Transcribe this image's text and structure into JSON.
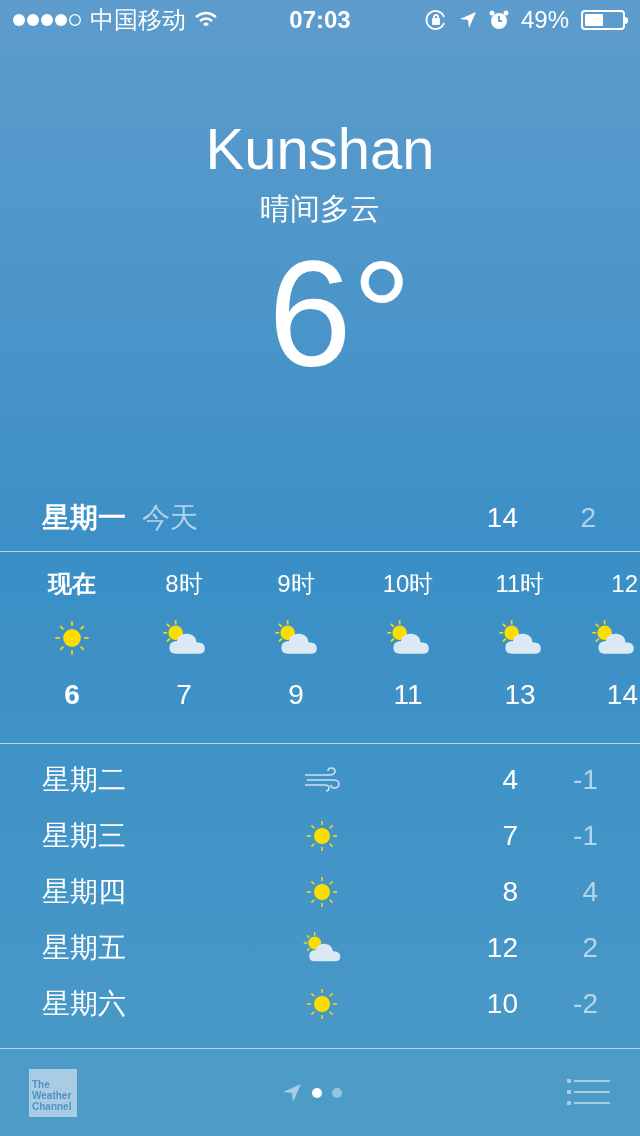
{
  "status_bar": {
    "carrier": "中国移动",
    "time": "07:03",
    "battery": "49%"
  },
  "location": {
    "city": "Kunshan",
    "condition": "晴间多云",
    "temperature": "6°"
  },
  "today": {
    "day": "星期一",
    "label": "今天",
    "high": "14",
    "low": "2"
  },
  "hourly": [
    {
      "time": "现在",
      "kind": "sunny",
      "temp": "6",
      "current": true
    },
    {
      "time": "8时",
      "kind": "partly-cloudy",
      "temp": "7",
      "current": false
    },
    {
      "time": "9时",
      "kind": "partly-cloudy",
      "temp": "9",
      "current": false
    },
    {
      "time": "10时",
      "kind": "partly-cloudy",
      "temp": "11",
      "current": false
    },
    {
      "time": "11时",
      "kind": "partly-cloudy",
      "temp": "13",
      "current": false
    },
    {
      "time": "12",
      "kind": "partly-cloudy",
      "temp": "14",
      "current": false
    }
  ],
  "daily": [
    {
      "day": "星期二",
      "kind": "windy",
      "high": "4",
      "low": "-1"
    },
    {
      "day": "星期三",
      "kind": "sunny",
      "high": "7",
      "low": "-1"
    },
    {
      "day": "星期四",
      "kind": "sunny",
      "high": "8",
      "low": "4"
    },
    {
      "day": "星期五",
      "kind": "partly-cloudy",
      "high": "12",
      "low": "2"
    },
    {
      "day": "星期六",
      "kind": "sunny",
      "high": "10",
      "low": "-2"
    }
  ],
  "footer": {
    "logo": "The Weather Channel",
    "pages": [
      {
        "selected": true
      },
      {
        "selected": false
      }
    ]
  }
}
